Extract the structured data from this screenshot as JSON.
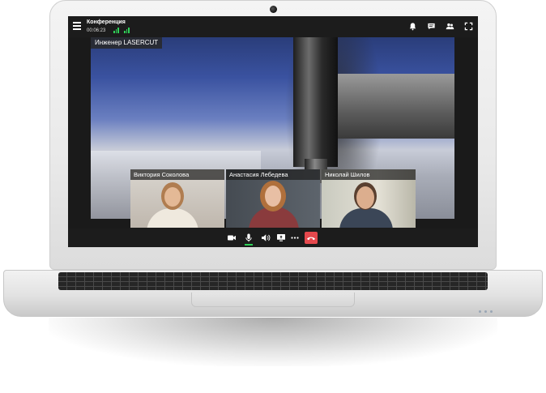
{
  "window": {
    "title": "Конференция",
    "timer": "00:06:23"
  },
  "icons": {
    "menu": "hamburger-menu-icon",
    "signal": "signal-strength-icon",
    "notifications": "bell-icon",
    "chat": "chat-icon",
    "participants": "users-icon",
    "fullscreen": "fullscreen-icon",
    "camera": "video-camera-icon",
    "microphone": "microphone-icon",
    "speaker": "speaker-volume-icon",
    "screen_share": "screen-share-icon",
    "more": "more-dots-icon",
    "hangup": "hang-up-phone-icon"
  },
  "main_video": {
    "speaker_name": "Инженер LASERCUT"
  },
  "participants": [
    {
      "name": "Виктория Соколова"
    },
    {
      "name": "Анастасия Лебедева"
    },
    {
      "name": "Николай Шилов"
    }
  ],
  "colors": {
    "accent_green": "#2fd158",
    "hangup_red": "#e5484d",
    "bar_dark": "#1c1c1c"
  }
}
